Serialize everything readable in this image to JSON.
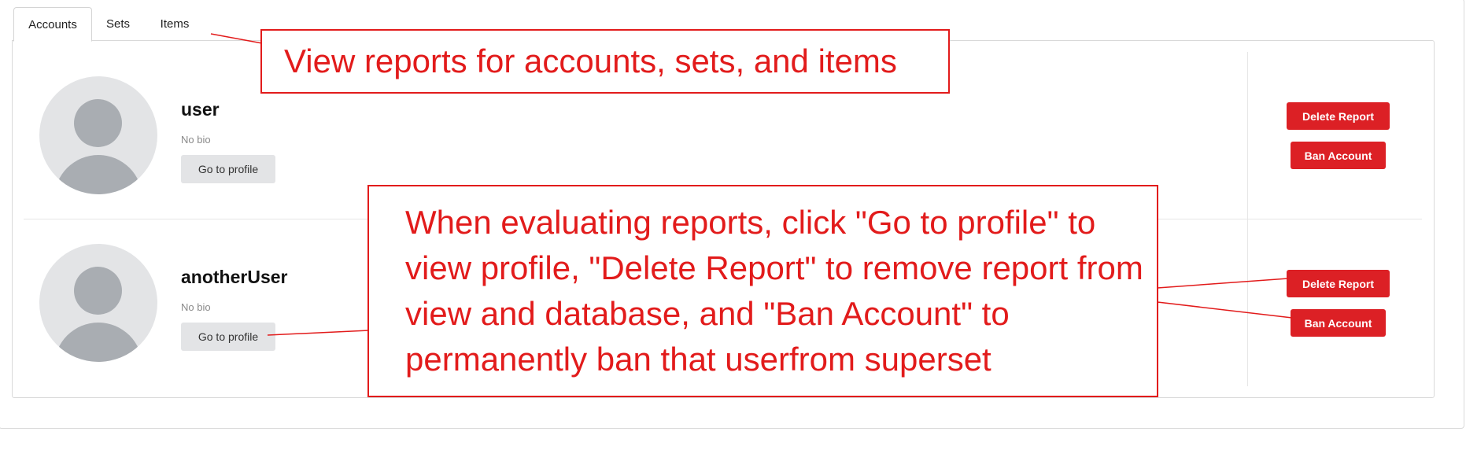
{
  "tabs": [
    {
      "label": "Accounts",
      "active": true
    },
    {
      "label": "Sets",
      "active": false
    },
    {
      "label": "Items",
      "active": false
    }
  ],
  "accounts": [
    {
      "username": "user",
      "bio": "No bio",
      "profile_button": "Go to profile",
      "delete_button": "Delete Report",
      "ban_button": "Ban Account"
    },
    {
      "username": "anotherUser",
      "bio": "No bio",
      "profile_button": "Go to profile",
      "delete_button": "Delete Report",
      "ban_button": "Ban Account"
    }
  ],
  "annotations": {
    "tabs_note": "View reports for accounts, sets, and items",
    "actions_note": "When evaluating reports, click \"Go to profile\" to view profile, \"Delete Report\" to remove report from view and database, and \"Ban Account\" to permanently ban that userfrom superset"
  },
  "colors": {
    "accent_red": "#dc2025",
    "annotation_red": "#e21b1b",
    "avatar_bg": "#e3e4e6",
    "avatar_fg": "#a9adb2"
  }
}
